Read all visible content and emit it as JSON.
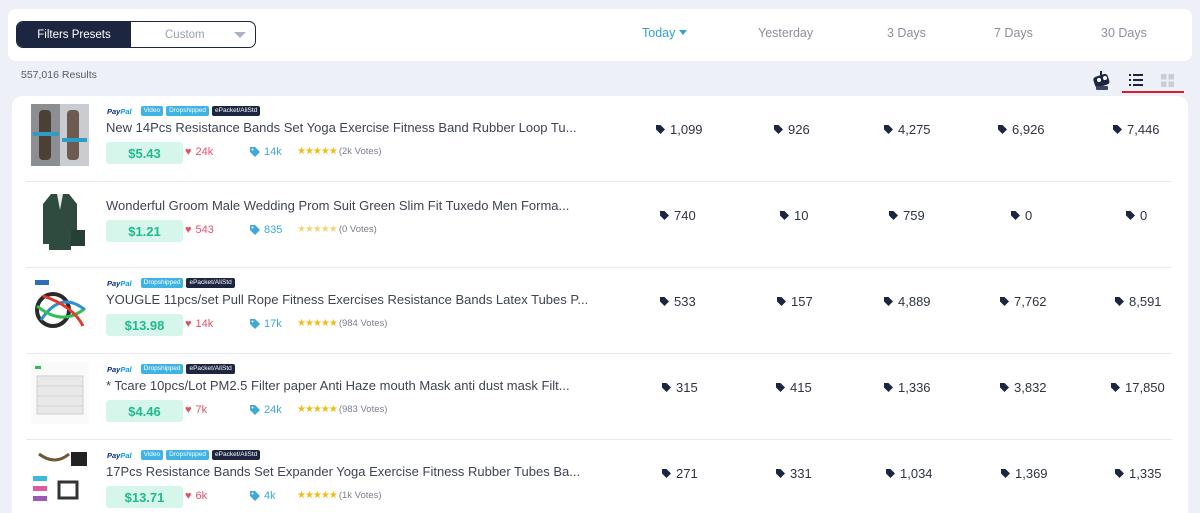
{
  "filters": {
    "preset_label": "Filters Presets",
    "custom_label": "Custom"
  },
  "periods": [
    {
      "label": "Today",
      "active": true
    },
    {
      "label": "Yesterday",
      "active": false
    },
    {
      "label": "3 Days",
      "active": false
    },
    {
      "label": "7 Days",
      "active": false
    },
    {
      "label": "30 Days",
      "active": false
    }
  ],
  "results": {
    "count_text": "557,016 Results"
  },
  "view": {
    "robot_icon": "robot-icon",
    "list_icon": "list-view-icon",
    "grid_icon": "grid-view-icon",
    "active": "list",
    "accent": "#d21f2d"
  },
  "colors": {
    "navy": "#1d2640",
    "price_bg": "#d6f6ec",
    "price_text": "#1fbb8b",
    "likes": "#e2516a",
    "orders": "#3fa8d8",
    "star": "#f2bb18",
    "link": "#2e9fd8"
  },
  "products": [
    {
      "title": "New 14Pcs Resistance Bands Set Yoga Exercise Fitness Band Rubber Loop Tu...",
      "price": "$5.43",
      "likes": "24k",
      "orders": "14k",
      "rating_text": "(2k Votes)",
      "stars_filled": true,
      "badges": {
        "paypal": true,
        "video": "Video",
        "dropshipped": "Dropshipped",
        "epacket": "ePacket/AliStd"
      },
      "paypal_a": "Pay",
      "paypal_b": "Pal",
      "stats": [
        "1,099",
        "926",
        "4,275",
        "6,926",
        "7,446"
      ]
    },
    {
      "title": "Wonderful Groom Male Wedding Prom Suit Green Slim Fit Tuxedo Men Forma...",
      "price": "$1.21",
      "likes": "543",
      "orders": "835",
      "rating_text": "(0 Votes)",
      "stars_filled": false,
      "badges": {
        "paypal": false
      },
      "stats": [
        "740",
        "10",
        "759",
        "0",
        "0"
      ]
    },
    {
      "title": "YOUGLE 11pcs/set Pull Rope Fitness Exercises Resistance Bands Latex Tubes P...",
      "price": "$13.98",
      "likes": "14k",
      "orders": "17k",
      "rating_text": "(984 Votes)",
      "stars_filled": true,
      "badges": {
        "paypal": true,
        "dropshipped": "Dropshipped",
        "epacket": "ePacket/AliStd"
      },
      "paypal_a": "Pay",
      "paypal_b": "Pal",
      "stats": [
        "533",
        "157",
        "4,889",
        "7,762",
        "8,591"
      ]
    },
    {
      "title": "* Tcare 10pcs/Lot PM2.5 Filter paper Anti Haze mouth Mask anti dust mask Filt...",
      "price": "$4.46",
      "likes": "7k",
      "orders": "24k",
      "rating_text": "(983 Votes)",
      "stars_filled": true,
      "badges": {
        "paypal": true,
        "dropshipped": "Dropshipped",
        "epacket": "ePacket/AliStd"
      },
      "paypal_a": "Pay",
      "paypal_b": "Pal",
      "stats": [
        "315",
        "415",
        "1,336",
        "3,832",
        "17,850"
      ]
    },
    {
      "title": "17Pcs Resistance Bands Set Expander Yoga Exercise Fitness Rubber Tubes Ba...",
      "price": "$13.71",
      "likes": "6k",
      "orders": "4k",
      "rating_text": "(1k Votes)",
      "stars_filled": true,
      "badges": {
        "paypal": true,
        "video": "Video",
        "dropshipped": "Dropshipped",
        "epacket": "ePacket/AliStd"
      },
      "paypal_a": "Pay",
      "paypal_b": "Pal",
      "stats": [
        "271",
        "331",
        "1,034",
        "1,369",
        "1,335"
      ]
    }
  ]
}
